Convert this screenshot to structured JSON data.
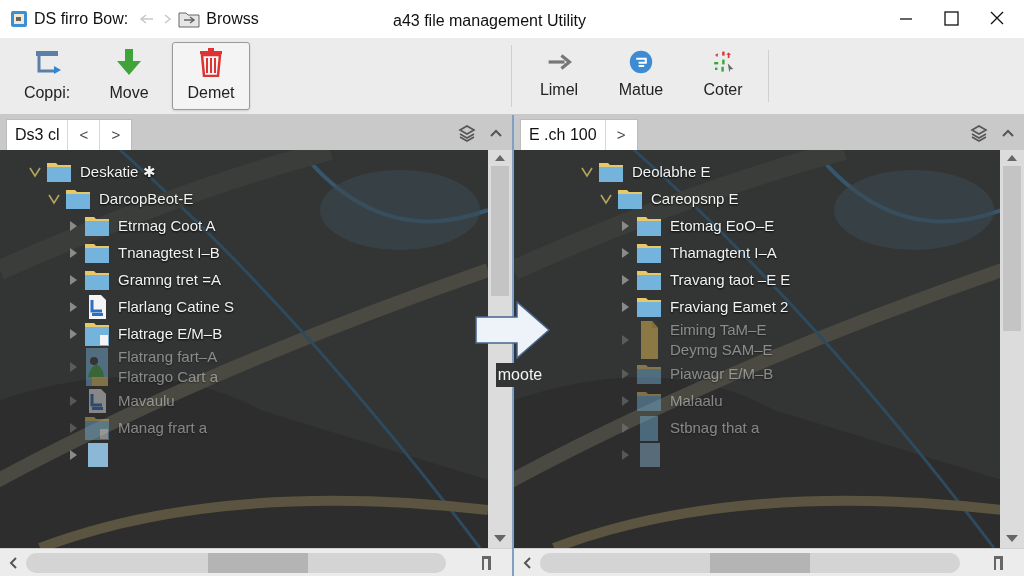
{
  "window": {
    "app_name": "DS firro Bow:",
    "location": "Browss",
    "title": "a43 file management Utility"
  },
  "toolbar": {
    "groups": [
      [
        {
          "label": "Coppi:",
          "kind": "copy",
          "selected": false
        },
        {
          "label": "Move",
          "kind": "move",
          "selected": false
        },
        {
          "label": "Demet",
          "kind": "delete",
          "selected": true
        }
      ],
      [
        {
          "label": "Limel",
          "kind": "arrow",
          "selected": false
        },
        {
          "label": "Matue",
          "kind": "circle",
          "selected": false
        },
        {
          "label": "Coter",
          "kind": "scatter",
          "selected": false
        }
      ]
    ]
  },
  "panes": [
    {
      "tab": "Ds3 cl",
      "nav": [
        "<",
        ">"
      ],
      "tree": [
        {
          "label": "Deskatie ✱",
          "kind": "folder",
          "expanded": true,
          "children": [
            {
              "label": "DarcopBeot-E",
              "kind": "folder",
              "expanded": true,
              "children": [
                {
                  "label": "Etrmag Coot A",
                  "kind": "folder",
                  "expanded": false,
                  "dimmed": false
                },
                {
                  "label": "Tnanagtest I–B",
                  "kind": "folder",
                  "expanded": false,
                  "dimmed": false
                },
                {
                  "label": "Gramng tret =A",
                  "kind": "folder",
                  "expanded": false,
                  "dimmed": false
                },
                {
                  "label": "Flarlang Catine S",
                  "kind": "document",
                  "expanded": false,
                  "dimmed": false
                },
                {
                  "label": "Flatrage E/M–B",
                  "kind": "folder-document",
                  "expanded": false,
                  "dimmed": false
                },
                {
                  "label": "Flatrang fart–A\nFlatrago Cart a",
                  "expanded": false,
                  "dimmed": true
                },
                {
                  "label": "Mavaulu",
                  "kind": "document",
                  "expanded": false,
                  "dimmed": true
                },
                {
                  "label": "Manag frart a",
                  "kind": "folder-document",
                  "expanded": false,
                  "dimmed": true
                },
                {
                  "kind": "blank",
                  "expanded": false,
                  "dimmed": false
                }
              ]
            }
          ]
        }
      ]
    },
    {
      "tab": "E .ch 100",
      "nav": [
        ">"
      ],
      "tree": [
        {
          "label": "Deolabhe E",
          "kind": "folder",
          "expanded": true,
          "children": [
            {
              "label": "Careopsnp E",
              "kind": "folder",
              "expanded": true,
              "children": [
                {
                  "label": "Etomag EoO–E",
                  "kind": "folder",
                  "expanded": false,
                  "dimmed": false
                },
                {
                  "label": "Thamagtent I–A",
                  "kind": "folder",
                  "expanded": false,
                  "dimmed": false
                },
                {
                  "label": "Travang taot –E E",
                  "kind": "folder",
                  "expanded": false,
                  "dimmed": false
                },
                {
                  "label": "Fraviang Eamet 2",
                  "kind": "folder",
                  "expanded": false,
                  "dimmed": false
                },
                {
                  "label": "Eiming TaM–E\nDeymg SAM–E",
                  "kind": "file",
                  "expanded": false,
                  "dimmed": true
                },
                {
                  "label": "Piawagr E/M–B",
                  "kind": "folder",
                  "expanded": false,
                  "dimmed": true
                },
                {
                  "label": "Malaalu",
                  "kind": "folder",
                  "expanded": false,
                  "dimmed": true
                },
                {
                  "label": "Stbnag that a",
                  "kind": "blank-blue",
                  "expanded": false,
                  "dimmed": true
                },
                {
                  "kind": "blank",
                  "expanded": false,
                  "dimmed": true
                }
              ]
            }
          ]
        }
      ]
    }
  ],
  "transfer": {
    "label": "moote"
  }
}
